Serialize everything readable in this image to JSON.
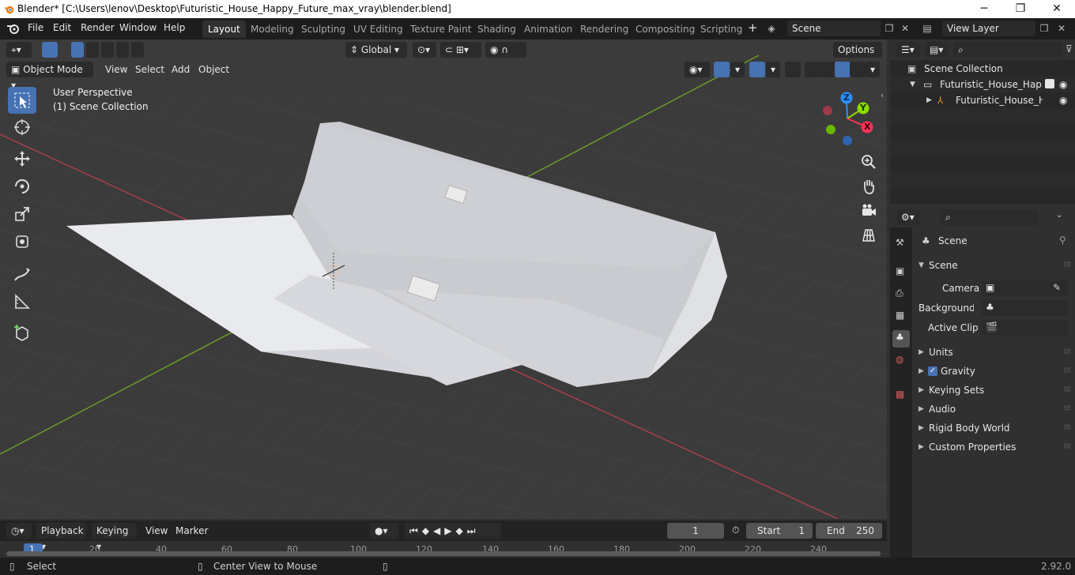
{
  "window": {
    "title": "Blender* [C:\\Users\\lenov\\Desktop\\Futuristic_House_Happy_Future_max_vray\\blender.blend]",
    "minimize": "─",
    "maximize": "❐",
    "close": "✕"
  },
  "menu": [
    "File",
    "Edit",
    "Render",
    "Window",
    "Help"
  ],
  "workspaces": [
    "Layout",
    "Modeling",
    "Sculpting",
    "UV Editing",
    "Texture Paint",
    "Shading",
    "Animation",
    "Rendering",
    "Compositing",
    "Scripting"
  ],
  "active_workspace": "Layout",
  "scene_selector": {
    "value": "Scene"
  },
  "view_layer_selector": {
    "value": "View Layer"
  },
  "viewport": {
    "transform_orientation": "Global",
    "options_label": "Options",
    "mode": "Object Mode",
    "header_menus": [
      "View",
      "Select",
      "Add",
      "Object"
    ],
    "perspective_label": "User Perspective",
    "collection_label": "(1) Scene Collection",
    "gizmo": {
      "z": "Z",
      "y": "Y",
      "x": "X"
    }
  },
  "outliner": {
    "root": "Scene Collection",
    "items": [
      {
        "label": "Futuristic_House_Happy",
        "level": 1
      },
      {
        "label": "Futuristic_House_Ha",
        "level": 2
      }
    ]
  },
  "properties": {
    "context_title": "Scene",
    "panel_title": "Scene",
    "fields": [
      {
        "label": "Camera"
      },
      {
        "label": "Background ..."
      },
      {
        "label": "Active Clip"
      }
    ],
    "subpanels": [
      "Units",
      "Gravity",
      "Keying Sets",
      "Audio",
      "Rigid Body World",
      "Custom Properties"
    ],
    "gravity_checked": true
  },
  "timeline": {
    "menus": [
      "Playback",
      "Keying",
      "View",
      "Marker"
    ],
    "current_frame": "1",
    "start_label": "Start",
    "start_value": "1",
    "end_label": "End",
    "end_value": "250",
    "ruler_ticks": [
      "1",
      "20",
      "40",
      "60",
      "80",
      "100",
      "120",
      "140",
      "160",
      "180",
      "200",
      "220",
      "240"
    ]
  },
  "status": {
    "select": "Select",
    "center_view": "Center View to Mouse",
    "version": "2.92.0"
  },
  "colors": {
    "accent": "#4772b3",
    "axis_x": "#ff3352",
    "axis_y": "#8bdc00",
    "axis_z": "#2890ff"
  }
}
